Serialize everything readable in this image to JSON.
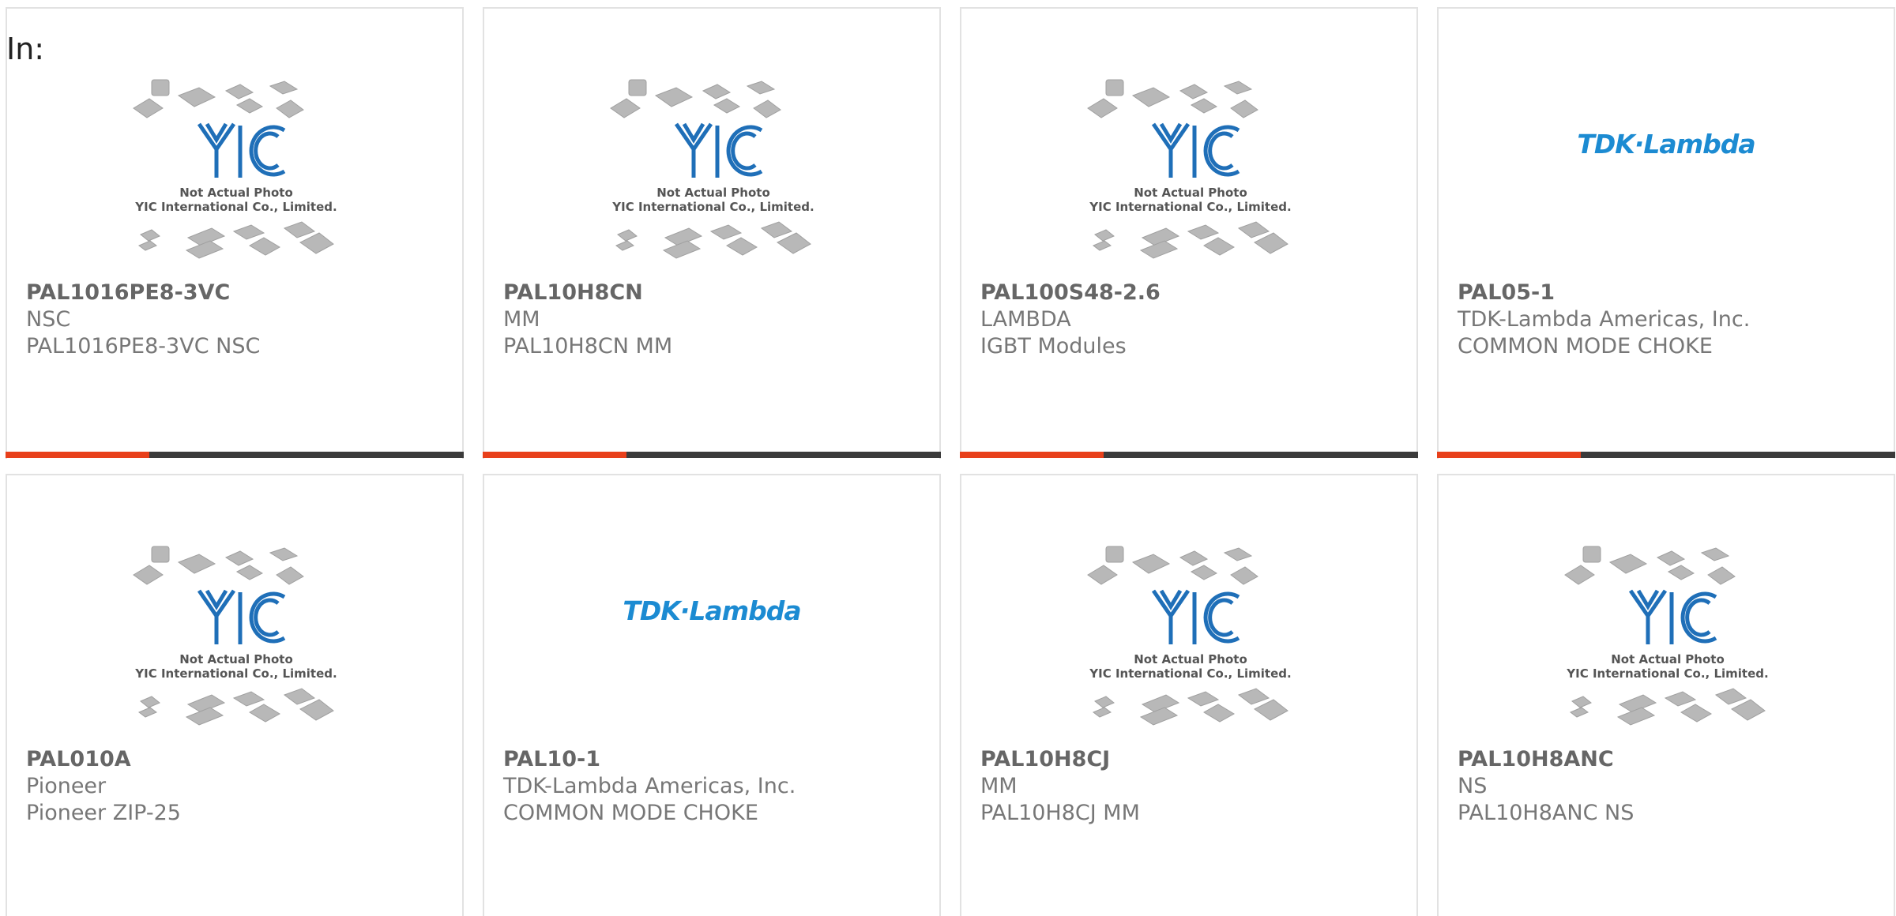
{
  "page_label": "In:",
  "colors": {
    "accent": "#e8401b",
    "bar": "#3b3b3b",
    "brand_tdk": "#1c8bd2",
    "yic_blue": "#1f6fb8"
  },
  "products": [
    {
      "part": "PAL1016PE8-3VC",
      "manufacturer": "NSC",
      "description": "PAL1016PE8-3VC NSC",
      "image": "yic-placeholder",
      "bar": true
    },
    {
      "part": "PAL10H8CN",
      "manufacturer": "MM",
      "description": "PAL10H8CN MM",
      "image": "yic-placeholder",
      "bar": true
    },
    {
      "part": "PAL100S48-2.6",
      "manufacturer": "LAMBDA",
      "description": "IGBT Modules",
      "image": "yic-placeholder",
      "bar": true
    },
    {
      "part": "PAL05-1",
      "manufacturer": "TDK-Lambda Americas, Inc.",
      "description": "COMMON MODE CHOKE",
      "image": "tdk-lambda-logo",
      "bar": true
    },
    {
      "part": "PAL010A",
      "manufacturer": "Pioneer",
      "description": "Pioneer ZIP-25",
      "image": "yic-placeholder",
      "bar": false
    },
    {
      "part": "PAL10-1",
      "manufacturer": "TDK-Lambda Americas, Inc.",
      "description": "COMMON MODE CHOKE",
      "image": "tdk-lambda-logo",
      "bar": false
    },
    {
      "part": "PAL10H8CJ",
      "manufacturer": "MM",
      "description": "PAL10H8CJ MM",
      "image": "yic-placeholder",
      "bar": false
    },
    {
      "part": "PAL10H8ANC",
      "manufacturer": "NS",
      "description": "PAL10H8ANC NS",
      "image": "yic-placeholder",
      "bar": false
    }
  ],
  "placeholder": {
    "line1": "Not Actual Photo",
    "line2": "YIC International Co., Limited.",
    "logo_text": "YIC"
  },
  "tdk_logo_text": "TDK·Lambda"
}
